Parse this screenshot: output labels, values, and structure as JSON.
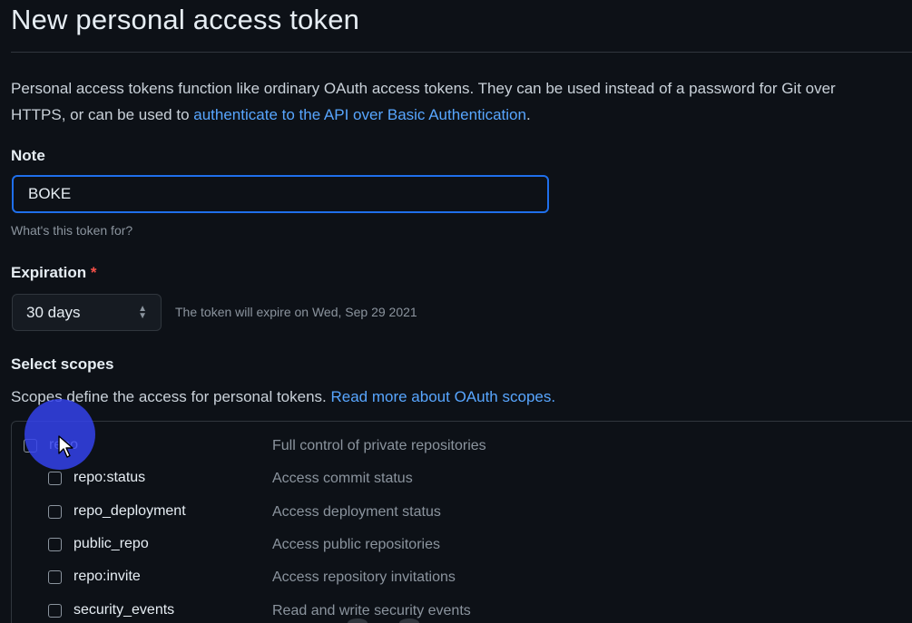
{
  "page": {
    "title": "New personal access token"
  },
  "intro": {
    "text_before": "Personal access tokens function like ordinary OAuth access tokens. They can be used instead of a password for Git over",
    "text_line2": "HTTPS, or can be used to ",
    "link": "authenticate to the API over Basic Authentication",
    "text_after": "."
  },
  "note": {
    "label": "Note",
    "value": "BOKE",
    "help": "What's this token for?"
  },
  "expiration": {
    "label": "Expiration",
    "required_marker": "*",
    "selected": "30 days",
    "expiry_text": "The token will expire on Wed, Sep 29 2021"
  },
  "scopes": {
    "heading": "Select scopes",
    "description": "Scopes define the access for personal tokens. ",
    "link": "Read more about OAuth scopes.",
    "items": [
      {
        "name": "repo",
        "description": "Full control of private repositories"
      },
      {
        "name": "repo:status",
        "description": "Access commit status"
      },
      {
        "name": "repo_deployment",
        "description": "Access deployment status"
      },
      {
        "name": "public_repo",
        "description": "Access public repositories"
      },
      {
        "name": "repo:invite",
        "description": "Access repository invitations"
      },
      {
        "name": "security_events",
        "description": "Read and write security events"
      }
    ]
  },
  "colors": {
    "background": "#0d1117",
    "link": "#58a6ff",
    "focus_border": "#1f6feb",
    "cursor_halo": "#3442eb"
  },
  "icons": {
    "select_arrows": "chevron-up-down-icon",
    "cursor": "mouse-pointer-icon"
  }
}
